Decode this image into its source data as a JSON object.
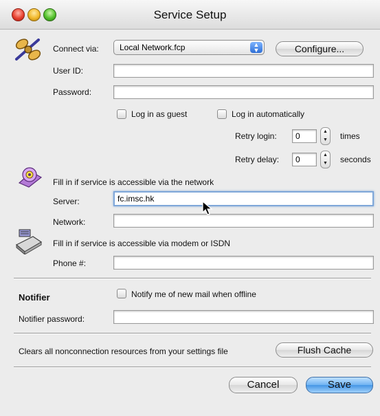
{
  "window": {
    "title": "Service Setup"
  },
  "connect": {
    "label": "Connect via:",
    "selected": "Local Network.fcp",
    "configure_label": "Configure..."
  },
  "login": {
    "user_id_label": "User ID:",
    "user_id_value": "",
    "password_label": "Password:",
    "password_value": "",
    "guest_label": "Log in as guest",
    "auto_label": "Log in automatically",
    "retry_login_label": "Retry login:",
    "retry_login_value": "0",
    "retry_login_unit": "times",
    "retry_delay_label": "Retry delay:",
    "retry_delay_value": "0",
    "retry_delay_unit": "seconds"
  },
  "network": {
    "heading": "Fill in if service is accessible via the network",
    "server_label": "Server:",
    "server_value": "fc.imsc.hk",
    "network_label": "Network:",
    "network_value": ""
  },
  "modem": {
    "heading": "Fill in if service is accessible via modem or ISDN",
    "phone_label": "Phone #:",
    "phone_value": ""
  },
  "notifier": {
    "heading": "Notifier",
    "notify_label": "Notify me of new mail when offline",
    "password_label": "Notifier password:",
    "password_value": ""
  },
  "cache": {
    "description": "Clears all nonconnection resources from your settings file",
    "flush_label": "Flush Cache"
  },
  "footer": {
    "cancel_label": "Cancel",
    "save_label": "Save"
  }
}
